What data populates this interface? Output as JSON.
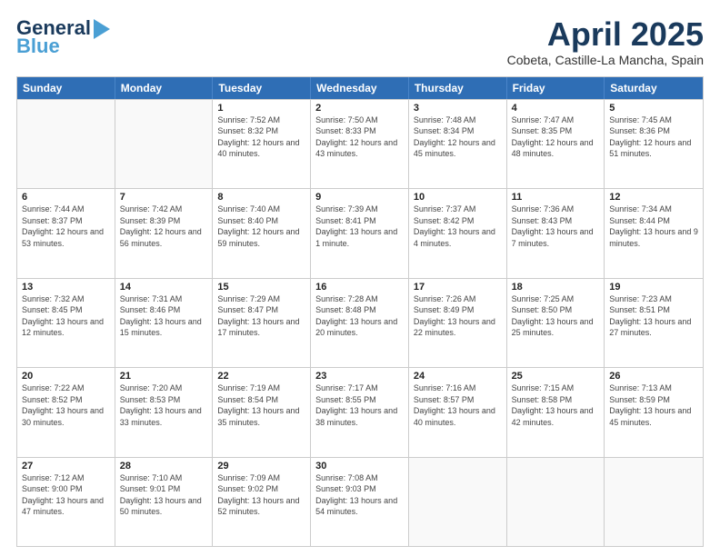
{
  "header": {
    "logo_line1": "General",
    "logo_line2": "Blue",
    "main_title": "April 2025",
    "subtitle": "Cobeta, Castille-La Mancha, Spain"
  },
  "calendar": {
    "days_of_week": [
      "Sunday",
      "Monday",
      "Tuesday",
      "Wednesday",
      "Thursday",
      "Friday",
      "Saturday"
    ],
    "rows": [
      [
        {
          "day": "",
          "info": ""
        },
        {
          "day": "",
          "info": ""
        },
        {
          "day": "1",
          "info": "Sunrise: 7:52 AM\nSunset: 8:32 PM\nDaylight: 12 hours and 40 minutes."
        },
        {
          "day": "2",
          "info": "Sunrise: 7:50 AM\nSunset: 8:33 PM\nDaylight: 12 hours and 43 minutes."
        },
        {
          "day": "3",
          "info": "Sunrise: 7:48 AM\nSunset: 8:34 PM\nDaylight: 12 hours and 45 minutes."
        },
        {
          "day": "4",
          "info": "Sunrise: 7:47 AM\nSunset: 8:35 PM\nDaylight: 12 hours and 48 minutes."
        },
        {
          "day": "5",
          "info": "Sunrise: 7:45 AM\nSunset: 8:36 PM\nDaylight: 12 hours and 51 minutes."
        }
      ],
      [
        {
          "day": "6",
          "info": "Sunrise: 7:44 AM\nSunset: 8:37 PM\nDaylight: 12 hours and 53 minutes."
        },
        {
          "day": "7",
          "info": "Sunrise: 7:42 AM\nSunset: 8:39 PM\nDaylight: 12 hours and 56 minutes."
        },
        {
          "day": "8",
          "info": "Sunrise: 7:40 AM\nSunset: 8:40 PM\nDaylight: 12 hours and 59 minutes."
        },
        {
          "day": "9",
          "info": "Sunrise: 7:39 AM\nSunset: 8:41 PM\nDaylight: 13 hours and 1 minute."
        },
        {
          "day": "10",
          "info": "Sunrise: 7:37 AM\nSunset: 8:42 PM\nDaylight: 13 hours and 4 minutes."
        },
        {
          "day": "11",
          "info": "Sunrise: 7:36 AM\nSunset: 8:43 PM\nDaylight: 13 hours and 7 minutes."
        },
        {
          "day": "12",
          "info": "Sunrise: 7:34 AM\nSunset: 8:44 PM\nDaylight: 13 hours and 9 minutes."
        }
      ],
      [
        {
          "day": "13",
          "info": "Sunrise: 7:32 AM\nSunset: 8:45 PM\nDaylight: 13 hours and 12 minutes."
        },
        {
          "day": "14",
          "info": "Sunrise: 7:31 AM\nSunset: 8:46 PM\nDaylight: 13 hours and 15 minutes."
        },
        {
          "day": "15",
          "info": "Sunrise: 7:29 AM\nSunset: 8:47 PM\nDaylight: 13 hours and 17 minutes."
        },
        {
          "day": "16",
          "info": "Sunrise: 7:28 AM\nSunset: 8:48 PM\nDaylight: 13 hours and 20 minutes."
        },
        {
          "day": "17",
          "info": "Sunrise: 7:26 AM\nSunset: 8:49 PM\nDaylight: 13 hours and 22 minutes."
        },
        {
          "day": "18",
          "info": "Sunrise: 7:25 AM\nSunset: 8:50 PM\nDaylight: 13 hours and 25 minutes."
        },
        {
          "day": "19",
          "info": "Sunrise: 7:23 AM\nSunset: 8:51 PM\nDaylight: 13 hours and 27 minutes."
        }
      ],
      [
        {
          "day": "20",
          "info": "Sunrise: 7:22 AM\nSunset: 8:52 PM\nDaylight: 13 hours and 30 minutes."
        },
        {
          "day": "21",
          "info": "Sunrise: 7:20 AM\nSunset: 8:53 PM\nDaylight: 13 hours and 33 minutes."
        },
        {
          "day": "22",
          "info": "Sunrise: 7:19 AM\nSunset: 8:54 PM\nDaylight: 13 hours and 35 minutes."
        },
        {
          "day": "23",
          "info": "Sunrise: 7:17 AM\nSunset: 8:55 PM\nDaylight: 13 hours and 38 minutes."
        },
        {
          "day": "24",
          "info": "Sunrise: 7:16 AM\nSunset: 8:57 PM\nDaylight: 13 hours and 40 minutes."
        },
        {
          "day": "25",
          "info": "Sunrise: 7:15 AM\nSunset: 8:58 PM\nDaylight: 13 hours and 42 minutes."
        },
        {
          "day": "26",
          "info": "Sunrise: 7:13 AM\nSunset: 8:59 PM\nDaylight: 13 hours and 45 minutes."
        }
      ],
      [
        {
          "day": "27",
          "info": "Sunrise: 7:12 AM\nSunset: 9:00 PM\nDaylight: 13 hours and 47 minutes."
        },
        {
          "day": "28",
          "info": "Sunrise: 7:10 AM\nSunset: 9:01 PM\nDaylight: 13 hours and 50 minutes."
        },
        {
          "day": "29",
          "info": "Sunrise: 7:09 AM\nSunset: 9:02 PM\nDaylight: 13 hours and 52 minutes."
        },
        {
          "day": "30",
          "info": "Sunrise: 7:08 AM\nSunset: 9:03 PM\nDaylight: 13 hours and 54 minutes."
        },
        {
          "day": "",
          "info": ""
        },
        {
          "day": "",
          "info": ""
        },
        {
          "day": "",
          "info": ""
        }
      ]
    ]
  }
}
